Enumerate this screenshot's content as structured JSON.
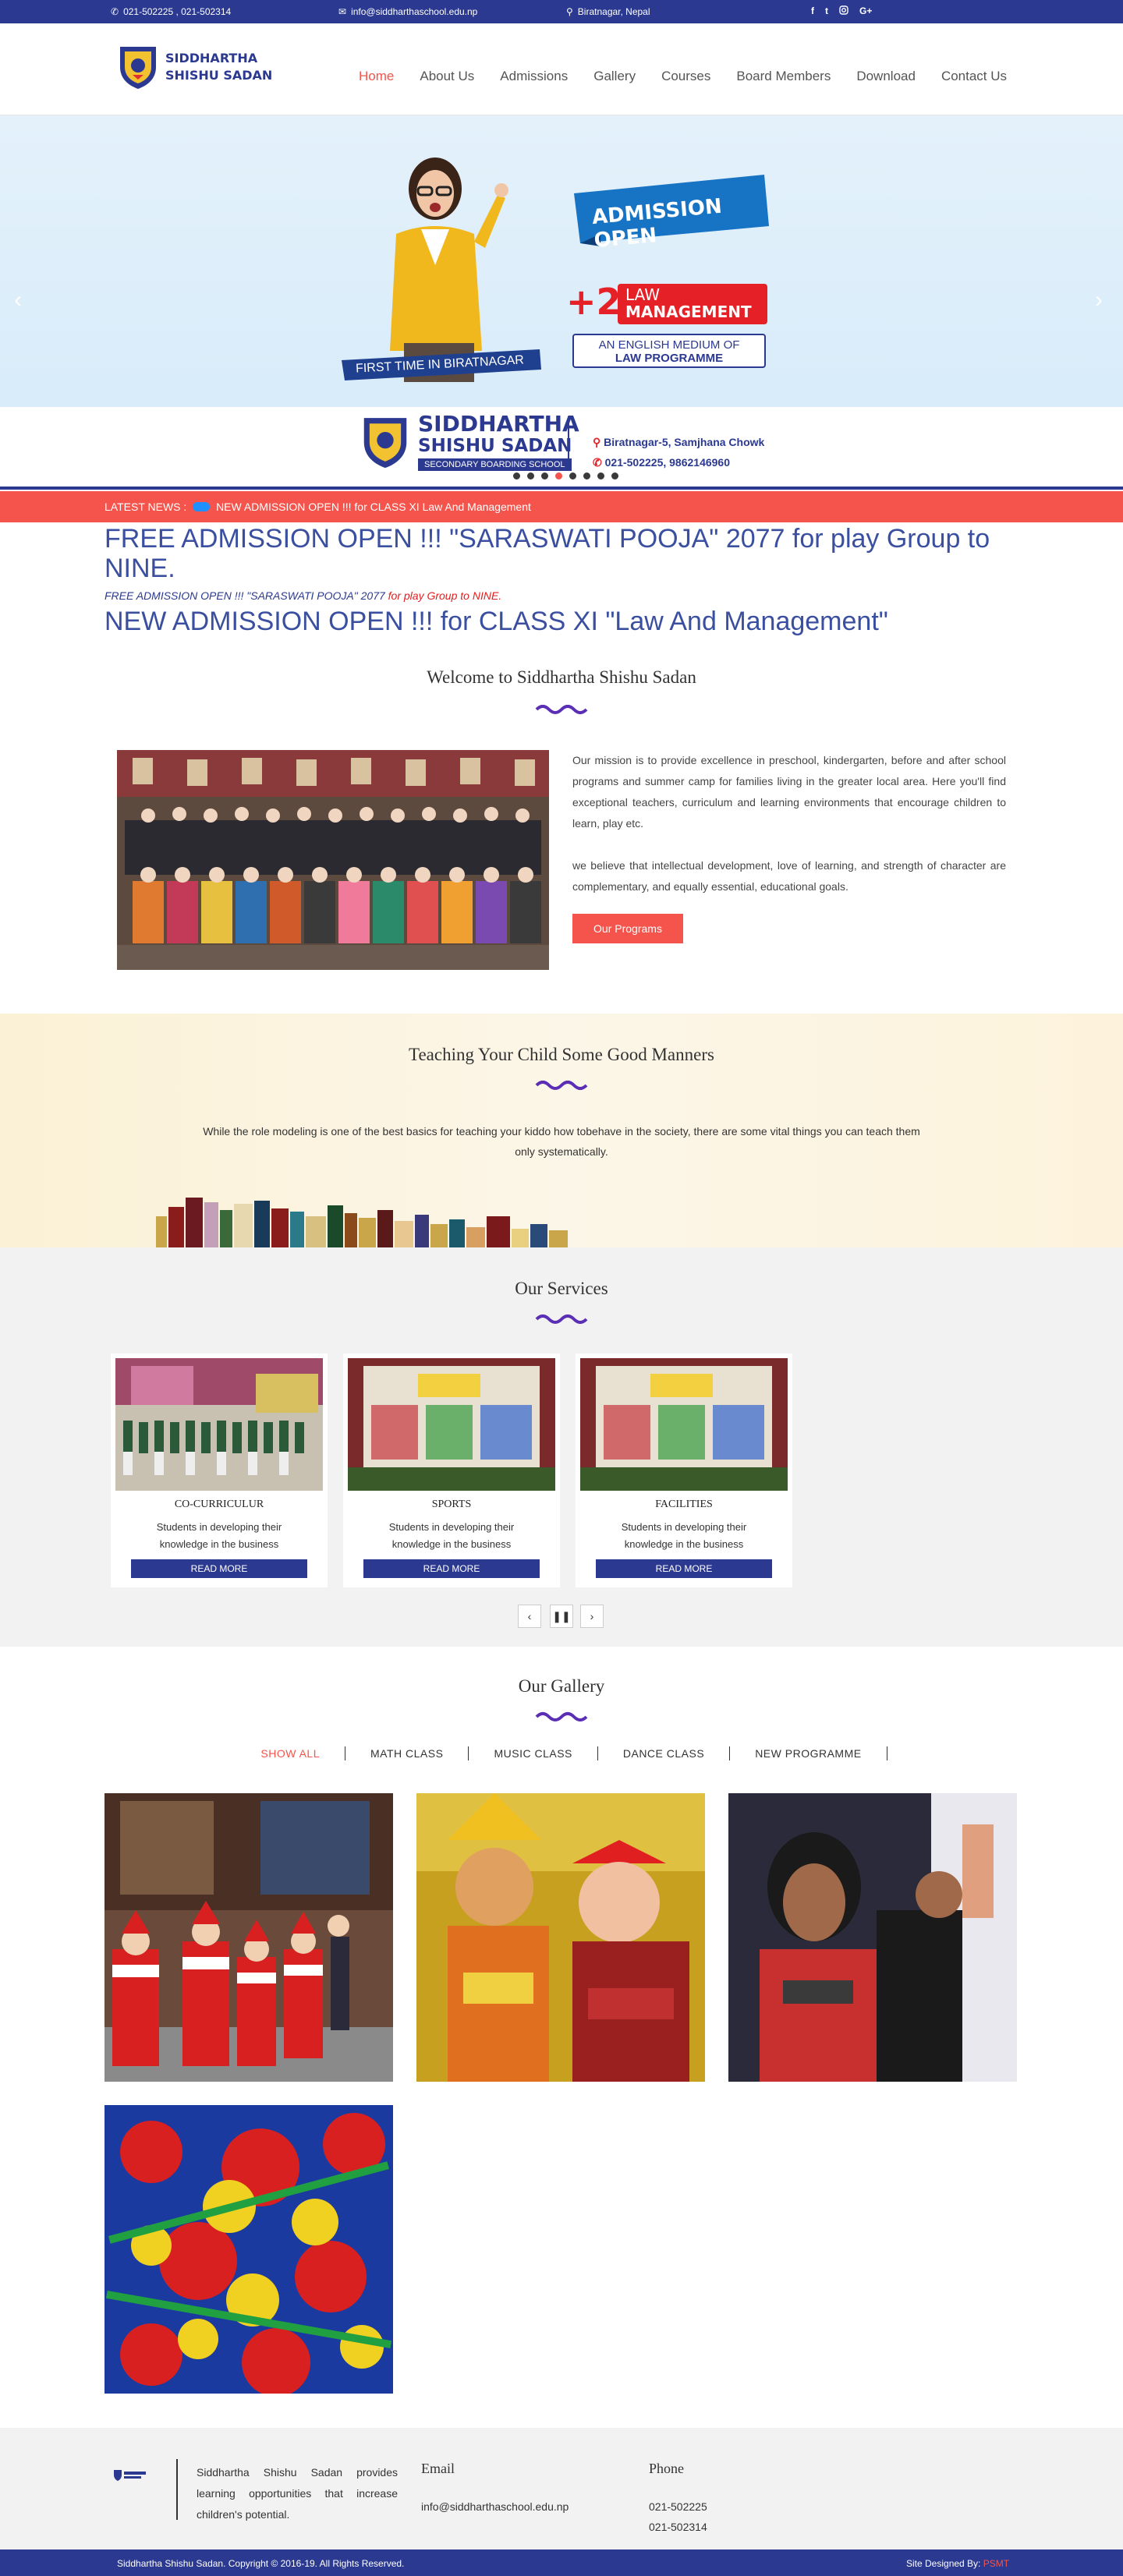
{
  "topbar": {
    "phone": "021-502225 , 021-502314",
    "email": "info@siddharthaschool.edu.np",
    "location": "Biratnagar, Nepal",
    "social": [
      "f",
      "t",
      "ig",
      "G+"
    ]
  },
  "brand": {
    "name": "SIDDHARTHA SHISHU SADAN"
  },
  "nav": [
    "Home",
    "About Us",
    "Admissions",
    "Gallery",
    "Courses",
    "Board Members",
    "Download",
    "Contact Us"
  ],
  "hero": {
    "admission": "ADMISSION OPEN",
    "plus2": "+2",
    "law1": "LAW",
    "law2": "MANAGEMENT",
    "english": "AN ENGLISH MEDIUM OF",
    "programme": "LAW PROGRAMME",
    "first_time": "FIRST TIME IN BIRATNAGAR",
    "school1": "SIDDHARTHA",
    "school2": "SHISHU SADAN",
    "school_sub": "SECONDARY BOARDING SCHOOL",
    "address": "Biratnagar-5, Samjhana Chowk",
    "phones": "021-502225, 9862146960",
    "slide_count": 8,
    "active_slide": 3
  },
  "news": {
    "label": "LATEST NEWS :",
    "text": "NEW ADMISSION OPEN !!! for CLASS XI Law And Management"
  },
  "flash": {
    "headline1": "FREE ADMISSION OPEN !!! \"SARASWATI POOJA\" 2077 for play Group to NINE.",
    "small_blue": "FREE ADMISSION OPEN !!! \"SARASWATI POOJA\"  2077 ",
    "small_red": "for play Group to NINE.",
    "headline2": "NEW ADMISSION OPEN !!! for CLASS XI \"Law And Management\""
  },
  "welcome": {
    "title": "Welcome to Siddhartha Shishu Sadan",
    "para1": "Our mission is to provide excellence in preschool, kindergarten, before and after school programs and summer camp for families living in the greater local area. Here you'll find exceptional teachers, curriculum and learning environments that encourage children to learn, play etc.",
    "para2": "we believe that intellectual development, love of learning, and strength of character are complementary, and equally essential, educational goals.",
    "button": "Our Programs"
  },
  "manners": {
    "title": "Teaching Your Child Some Good Manners",
    "text": "While the role modeling is one of the best basics for teaching your kiddo how tobehave in the society, there are some vital things you can teach them only systematically."
  },
  "services": {
    "title": "Our Services",
    "cards": [
      {
        "title": "CO-CURRICULUR",
        "desc": "Students in developing their knowledge in the business",
        "button": "READ MORE"
      },
      {
        "title": "SPORTS",
        "desc": "Students in developing their knowledge in the business",
        "button": "READ MORE"
      },
      {
        "title": "FACILITIES",
        "desc": "Students in developing their knowledge in the business",
        "button": "READ MORE"
      }
    ]
  },
  "gallery": {
    "title": "Our Gallery",
    "filters": [
      "SHOW ALL",
      "MATH CLASS",
      "MUSIC CLASS",
      "DANCE CLASS",
      "NEW PROGRAMME"
    ]
  },
  "footer": {
    "desc": "Siddhartha Shishu Sadan provides learning opportunities that increase children's potential.",
    "email_title": "Email",
    "email": "info@siddharthaschool.edu.np",
    "phone_title": "Phone",
    "phone1": "021-502225",
    "phone2": "021-502314",
    "copyright": "Siddhartha Shishu Sadan. Copyright © 2016-19. All Rights Reserved.",
    "designed_by": "Site Designed By: ",
    "designer": "PSMT"
  },
  "colors": {
    "primary": "#2b3990",
    "accent": "#f4544b"
  }
}
